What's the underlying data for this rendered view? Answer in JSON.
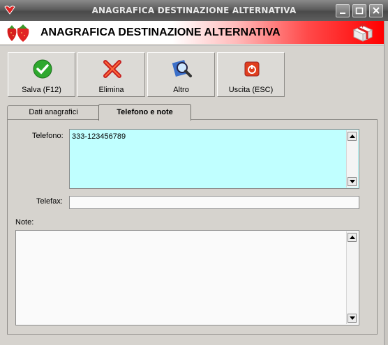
{
  "window": {
    "title": "ANAGRAFICA DESTINAZIONE ALTERNATIVA",
    "controls": [
      "minimize-icon",
      "maximize-icon",
      "close-icon"
    ]
  },
  "header": {
    "title": "ANAGRAFICA DESTINAZIONE ALTERNATIVA",
    "logo_icon": "strawberries-icon",
    "right_icon": "gift-box-icon"
  },
  "toolbar": {
    "save_label": "Salva (F12)",
    "delete_label": "Elimina",
    "other_label": "Altro",
    "exit_label": "Uscita (ESC)"
  },
  "tabs": [
    {
      "label": "Dati anagrafici",
      "active": false
    },
    {
      "label": "Telefono e note",
      "active": true
    }
  ],
  "form": {
    "telefono_label": "Telefono:",
    "telefono_value": "333-123456789",
    "telefax_label": "Telefax:",
    "telefax_value": "",
    "note_label": "Note:",
    "note_value": ""
  },
  "colors": {
    "telefono_field_bg": "#c0ffff",
    "header_gradient_end": "#ff0000",
    "window_bg": "#d6d3ce"
  }
}
